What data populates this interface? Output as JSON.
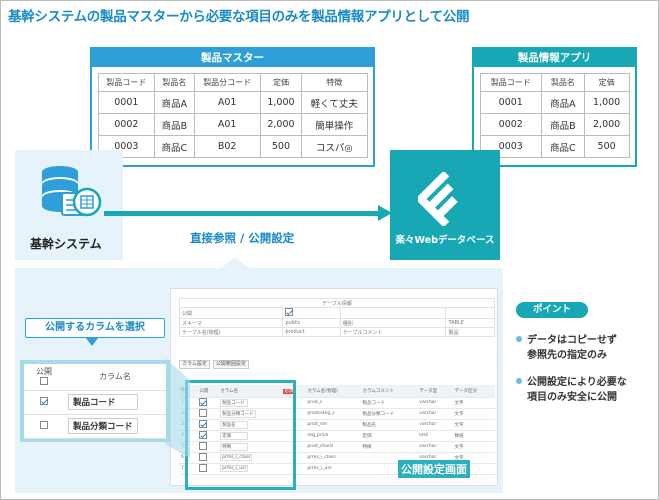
{
  "title": "基幹システムの製品マスターから必要な項目のみを製品情報アプリとして公開",
  "master": {
    "header": "製品マスター",
    "columns": [
      "製品コード",
      "製品名",
      "製品分コード",
      "定価",
      "特徴"
    ],
    "rows": [
      [
        "0001",
        "商品A",
        "A01",
        "1,000",
        "軽くて丈夫"
      ],
      [
        "0002",
        "商品B",
        "A01",
        "2,000",
        "簡単操作"
      ],
      [
        "0003",
        "商品C",
        "B02",
        "500",
        "コスパ◎"
      ]
    ]
  },
  "app": {
    "header": "製品情報アプリ",
    "columns": [
      "製品コード",
      "製品名",
      "定価"
    ],
    "rows": [
      [
        "0001",
        "商品A",
        "1,000"
      ],
      [
        "0002",
        "商品B",
        "2,000"
      ],
      [
        "0003",
        "商品C",
        "500"
      ]
    ]
  },
  "system_label": "基幹システム",
  "direct_label": "直接参照 / 公開設定",
  "web_db_name": "楽々Webデータベース",
  "point": {
    "badge": "ポイント",
    "items": [
      {
        "line1": "データはコピーせず",
        "line2": "参照先の指定のみ"
      },
      {
        "line1": "公開設定により必要な",
        "line2": "項目のみ安全に公開"
      }
    ]
  },
  "callout": "公開するカラムを選択",
  "column_select": {
    "col_public": "公開",
    "col_name": "カラム名",
    "rows": [
      {
        "checked": true,
        "name": "製品コード"
      },
      {
        "checked": false,
        "name": "製品分類コード"
      }
    ]
  },
  "screen": {
    "info_title": "テーブル情報",
    "info_rows": [
      [
        "公開",
        "",
        "",
        ""
      ],
      [
        "スキーマ",
        "public",
        "種別",
        "TABLE"
      ],
      [
        "テーブル名(物理)",
        "product",
        "テーブルコメント",
        "製品"
      ]
    ],
    "buttons": [
      "カラム設定",
      "公開範囲設定"
    ],
    "grid_header": [
      "No.",
      "公開",
      "カラム名",
      "必須",
      "カラム名(物理)",
      "カラムコメント",
      "データ型",
      "データ区分"
    ],
    "grid_rows": [
      [
        "1",
        true,
        "製品コード",
        "prod_c",
        "製品コード",
        "varchar",
        "文字"
      ],
      [
        "2",
        false,
        "製品分類コード",
        "prodcateg_c",
        "製品分類コード",
        "varchar",
        "文字"
      ],
      [
        "3",
        true,
        "製品名",
        "prod_nm",
        "製品名",
        "varchar",
        "文字"
      ],
      [
        "4",
        true,
        "定価",
        "reg_price",
        "定価",
        "int4",
        "数値"
      ],
      [
        "5",
        false,
        "特徴",
        "prod_charis",
        "特徴",
        "varchar",
        "文字"
      ],
      [
        "6",
        false,
        "prms_i_class",
        "prms_i_class",
        "",
        "varchar",
        "文字"
      ],
      [
        "7",
        false,
        "prms_i_usr",
        "prms_i_usr",
        "",
        "varchar",
        "文字"
      ]
    ],
    "label": "公開設定画面"
  }
}
